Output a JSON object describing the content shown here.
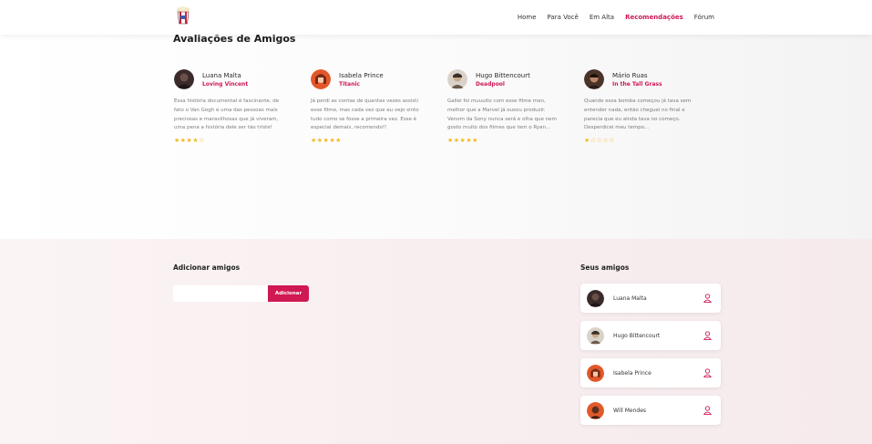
{
  "nav": {
    "items": [
      {
        "label": "Home",
        "active": false
      },
      {
        "label": "Para Você",
        "active": false
      },
      {
        "label": "Em Alta",
        "active": false
      },
      {
        "label": "Recomendações",
        "active": true
      },
      {
        "label": "Fórum",
        "active": false
      }
    ]
  },
  "reviews": {
    "title": "Avaliações de Amigos",
    "items": [
      {
        "name": "Luana Malta",
        "movie": "Loving Vincent",
        "text": "Essa história documental é fascinante, de fato o Van Gogh é uma das pessoas mais preciosas e maravilhosas que já viveram, uma pena a história dele ser tão triste!",
        "stars": "★★★★☆",
        "rating": 4,
        "avatar_color": "#3a2a2a"
      },
      {
        "name": "Isabela Prince",
        "movie": "Titanic",
        "text": "Já perdi as contas de quantas vezes assisti esse filme, mas cada vez que eu vejo sinto tudo como se fosse a primeira vez. Esse é especial demais, recomendo!!",
        "stars": "★★★★★",
        "rating": 5,
        "avatar_color": "#e2572a"
      },
      {
        "name": "Hugo Bittencourt",
        "movie": "Deadpool",
        "text": "Gallei foi muuuito com esse filme man, melhor que a Marvel já ousou produzir. Venom da Sony nunca será e olha que nem gosto muito dos filmes que tem o Ryan...",
        "stars": "★★★★★",
        "rating": 5,
        "avatar_color": "#b8a89a"
      },
      {
        "name": "Mário Ruas",
        "movie": "In the Tall Grass",
        "text": "Quando essa bomba começou já tava sem entender nada, então cheguei no final e parecia que eu ainda tava no começo. Desperdicei meu tempo...",
        "stars": "★☆☆☆☆",
        "rating": 1,
        "avatar_color": "#4a3328"
      }
    ]
  },
  "add_friends": {
    "title": "Adicionar amigos",
    "input_value": "",
    "input_placeholder": "",
    "button_label": "Adicionar"
  },
  "my_friends": {
    "title": "Seus amigos",
    "items": [
      {
        "name": "Luana Malta",
        "avatar_color": "#3a2a2a"
      },
      {
        "name": "Hugo Bittencourt",
        "avatar_color": "#b8a89a"
      },
      {
        "name": "Isabela Prince",
        "avatar_color": "#e2572a"
      },
      {
        "name": "Will Mendes",
        "avatar_color": "#e0592a"
      }
    ]
  },
  "colors": {
    "accent": "#d01852",
    "star": "#f3b821"
  }
}
